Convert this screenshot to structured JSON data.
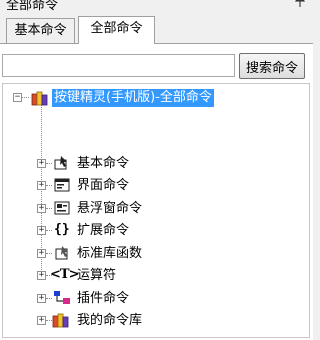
{
  "window": {
    "title": "全部命令",
    "pin_icon": "pin-icon"
  },
  "tabs": [
    {
      "label": "基本命令",
      "selected": false
    },
    {
      "label": "全部命令",
      "selected": true
    }
  ],
  "search": {
    "value": "",
    "placeholder": "",
    "button_label": "搜索命令"
  },
  "tree": {
    "root": {
      "label": "按键精灵(手机版)-全部命令",
      "icon": "books-icon",
      "expanded": true,
      "selected": true
    },
    "items": [
      {
        "label": "基本命令",
        "icon": "cursor-icon"
      },
      {
        "label": "界面命令",
        "icon": "window-icon"
      },
      {
        "label": "悬浮窗命令",
        "icon": "floating-window-icon"
      },
      {
        "label": "扩展命令",
        "icon": "braces-icon"
      },
      {
        "label": "标准库函数",
        "icon": "function-icon"
      },
      {
        "label": "运算符",
        "icon": "operator-icon"
      },
      {
        "label": "插件命令",
        "icon": "plugin-icon"
      },
      {
        "label": "我的命令库",
        "icon": "books-icon"
      }
    ]
  },
  "colors": {
    "selection": "#3399ff",
    "background": "#ffffff",
    "chrome": "#f0f0f0"
  }
}
